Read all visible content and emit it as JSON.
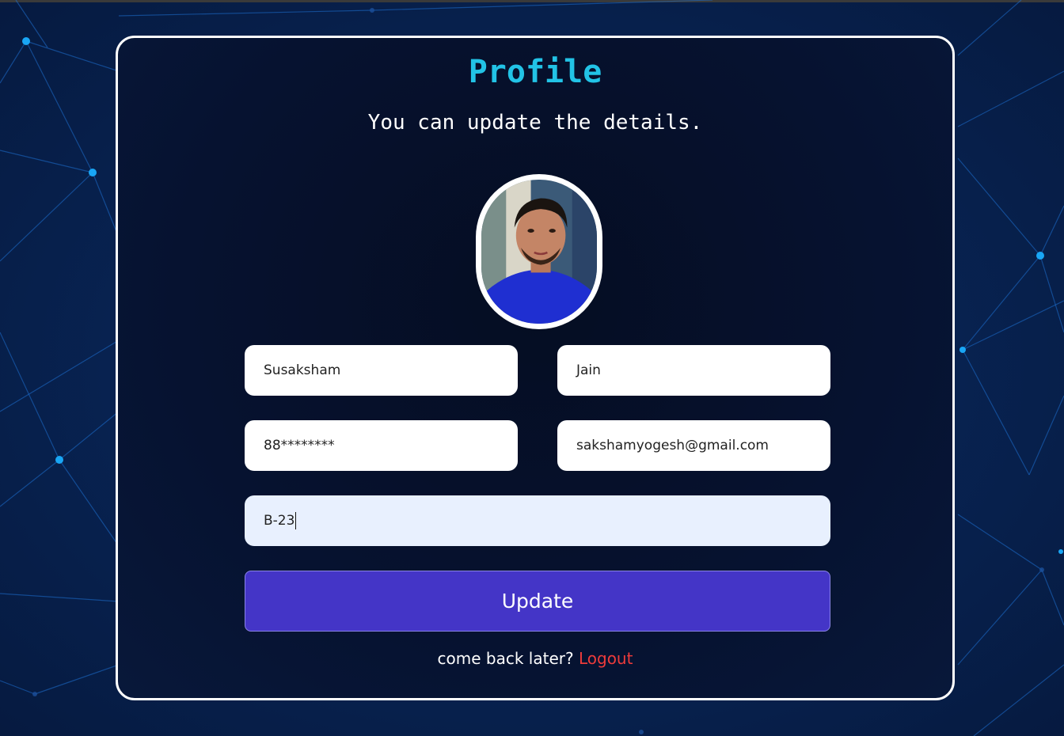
{
  "colors": {
    "title": "#22c3e6",
    "button_bg": "#4435c7",
    "logout": "#ee3b3b",
    "card_border": "#ffffff",
    "background": "#082454"
  },
  "profile": {
    "title": "Profile",
    "subtitle": "You can update the details.",
    "avatar": "profile-photo"
  },
  "form": {
    "first_name": "Susaksham",
    "last_name": "Jain",
    "phone": "88********",
    "email": "sakshamyogesh@gmail.com",
    "address": "B-23",
    "update_label": "Update"
  },
  "footer": {
    "prompt": "come back later?",
    "logout_label": "Logout"
  }
}
